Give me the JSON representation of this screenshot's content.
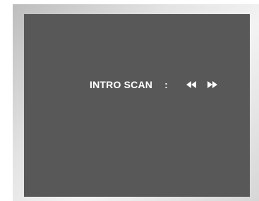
{
  "osd": {
    "label": "INTRO SCAN",
    "separator": ":",
    "controls": [
      {
        "name": "rewind",
        "icon": "rewind-icon"
      },
      {
        "name": "fast-forward",
        "icon": "fast-forward-icon"
      }
    ]
  },
  "colors": {
    "screen_background": "#575857",
    "text": "#ffffff",
    "frame": "#e3e3e3"
  }
}
